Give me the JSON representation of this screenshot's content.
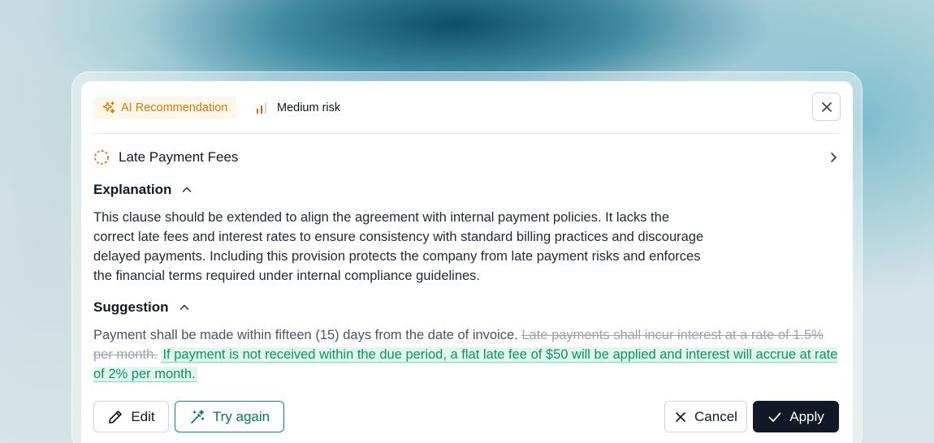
{
  "header": {
    "ai_label": "AI Recommendation",
    "risk_label": "Medium risk",
    "icons": [
      "sparkles-icon",
      "signal-bars-icon",
      "close-icon"
    ]
  },
  "clause": {
    "title": "Late Payment Fees",
    "icons": [
      "dashed-circle-icon",
      "chevron-right-icon"
    ]
  },
  "explanation": {
    "heading": "Explanation",
    "lines": [
      "This clause should be extended to align the agreement with internal payment policies. It lacks the",
      "correct late fees and interest rates to ensure consistency with standard billing practices and discourage",
      "delayed payments. Including this provision protects the company from late payment risks and enforces",
      "the financial terms required under internal compliance guidelines."
    ]
  },
  "suggestion": {
    "heading": "Suggestion",
    "kept_text": "Payment shall be made within fifteen (15) days from the date of invoice.",
    "deleted_text": "Late payments shall incur interest at a rate of 1.5% per month.",
    "inserted_text": "If payment is not received within the due period, a flat late fee of $50 will be applied and interest will accrue at rate of 2% per month."
  },
  "actions": {
    "edit_label": "Edit",
    "try_again_label": "Try again",
    "cancel_label": "Cancel",
    "apply_label": "Apply"
  },
  "colors": {
    "accent_orange": "#d97706",
    "insert_green": "#059669",
    "insert_bg": "#e3f6ed",
    "primary_dark": "#111827"
  }
}
